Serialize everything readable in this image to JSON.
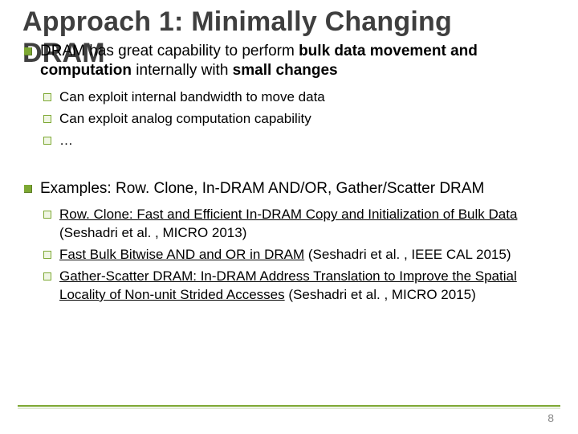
{
  "colors": {
    "accent": "#7da833",
    "title": "#3f3f3f"
  },
  "title": {
    "line1": "Approach 1: Minimally Changing",
    "line2": "DRAM"
  },
  "bullets": {
    "b1": {
      "prefix": "DRAM has great capability to perform ",
      "bold1": "bulk data movement and computation",
      "mid": " internally with ",
      "bold2": "small changes",
      "subs": {
        "s1": "Can exploit internal bandwidth to move data",
        "s2": "Can exploit analog computation capability",
        "s3": "…"
      }
    },
    "b2": {
      "text": "Examples: Row. Clone, In-DRAM AND/OR, Gather/Scatter DRAM",
      "subs": {
        "s1": {
          "u": "Row. Clone: Fast and Efficient In-DRAM Copy and Initialization of Bulk Data",
          "tail": " (Seshadri et al. , MICRO 2013)"
        },
        "s2": {
          "u": "Fast Bulk Bitwise AND and OR in DRAM",
          "tail": " (Seshadri et al. , IEEE CAL 2015)"
        },
        "s3": {
          "u": "Gather-Scatter DRAM: In-DRAM Address Translation to Improve the Spatial Locality of Non-unit Strided Accesses",
          "tail": " (Seshadri et al. , MICRO 2015)"
        }
      }
    }
  },
  "page_number": "8"
}
